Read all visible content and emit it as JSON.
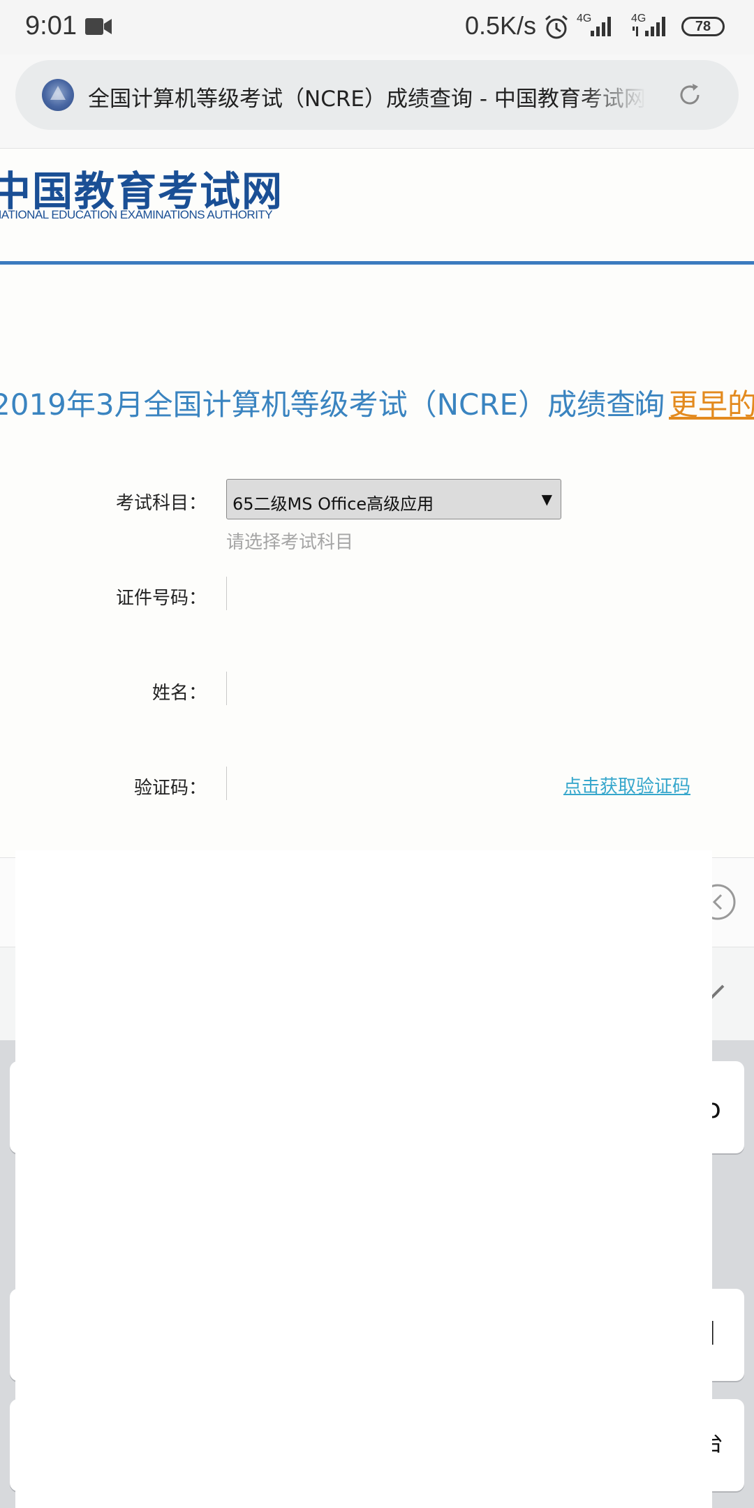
{
  "status_bar": {
    "time": "9:01",
    "net_speed": "0.5K/s",
    "signal1_label": "4G",
    "signal2_label": "4G",
    "battery": "78",
    "icons": [
      "video-camera-icon",
      "alarm-clock-icon",
      "signal-icon",
      "signal-icon",
      "battery-icon"
    ]
  },
  "browser": {
    "page_title": "全国计算机等级考试（NCRE）成绩查询 - 中国教育考试网",
    "icons": [
      "site-favicon-icon",
      "reload-icon"
    ]
  },
  "site": {
    "logo_cn": "中国教育考试网",
    "logo_en": "NATIONAL EDUCATION EXAMINATIONS AUTHORITY",
    "brand_color": "#1a4f95"
  },
  "page": {
    "heading": "2019年3月全国计算机等级考试（NCRE）成绩查询",
    "separator": "|",
    "earlier_link": "更早的"
  },
  "form": {
    "subject_label": "考试科目：",
    "subject_value": "65二级MS Office高级应用",
    "subject_hint": "请选择考试科目",
    "id_label": "证件号码：",
    "id_value": "",
    "name_label": "姓名：",
    "name_value": "",
    "captcha_label": "验证码：",
    "captcha_value": "",
    "captcha_link": "点击获取验证码"
  },
  "colors": {
    "heading": "#3a84c0",
    "link_orange": "#e38a1e",
    "link_cyan": "#37a7cc",
    "header_rule": "#3b7bbf"
  }
}
